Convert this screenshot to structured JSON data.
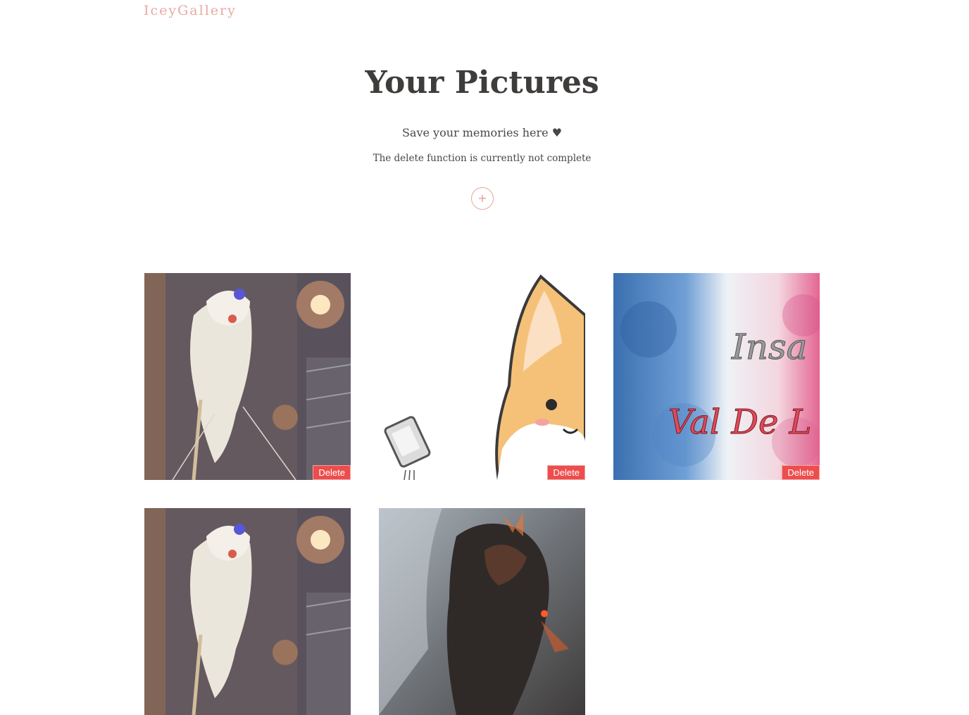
{
  "header": {
    "brand": "IceyGallery"
  },
  "hero": {
    "title": "Your Pictures",
    "tagline": "Save your memories here ♥",
    "note": "The delete function is currently not complete",
    "add_label": "+"
  },
  "gallery": {
    "delete_label": "Delete",
    "items": [
      {
        "subject": "lion-dance-photo"
      },
      {
        "subject": "corgi-cartoon-illustration"
      },
      {
        "subject": "watercolor-insa-val-de-loire-art",
        "caption_art": "Insa Val De L"
      },
      {
        "subject": "lion-dance-photo"
      },
      {
        "subject": "dark-armored-warrior-art"
      }
    ]
  },
  "colors": {
    "brand": "#e8a9a0",
    "heading": "#3f3d3b",
    "accent_circle": "#eaa59d",
    "delete_bg": "#ee4d4d"
  }
}
